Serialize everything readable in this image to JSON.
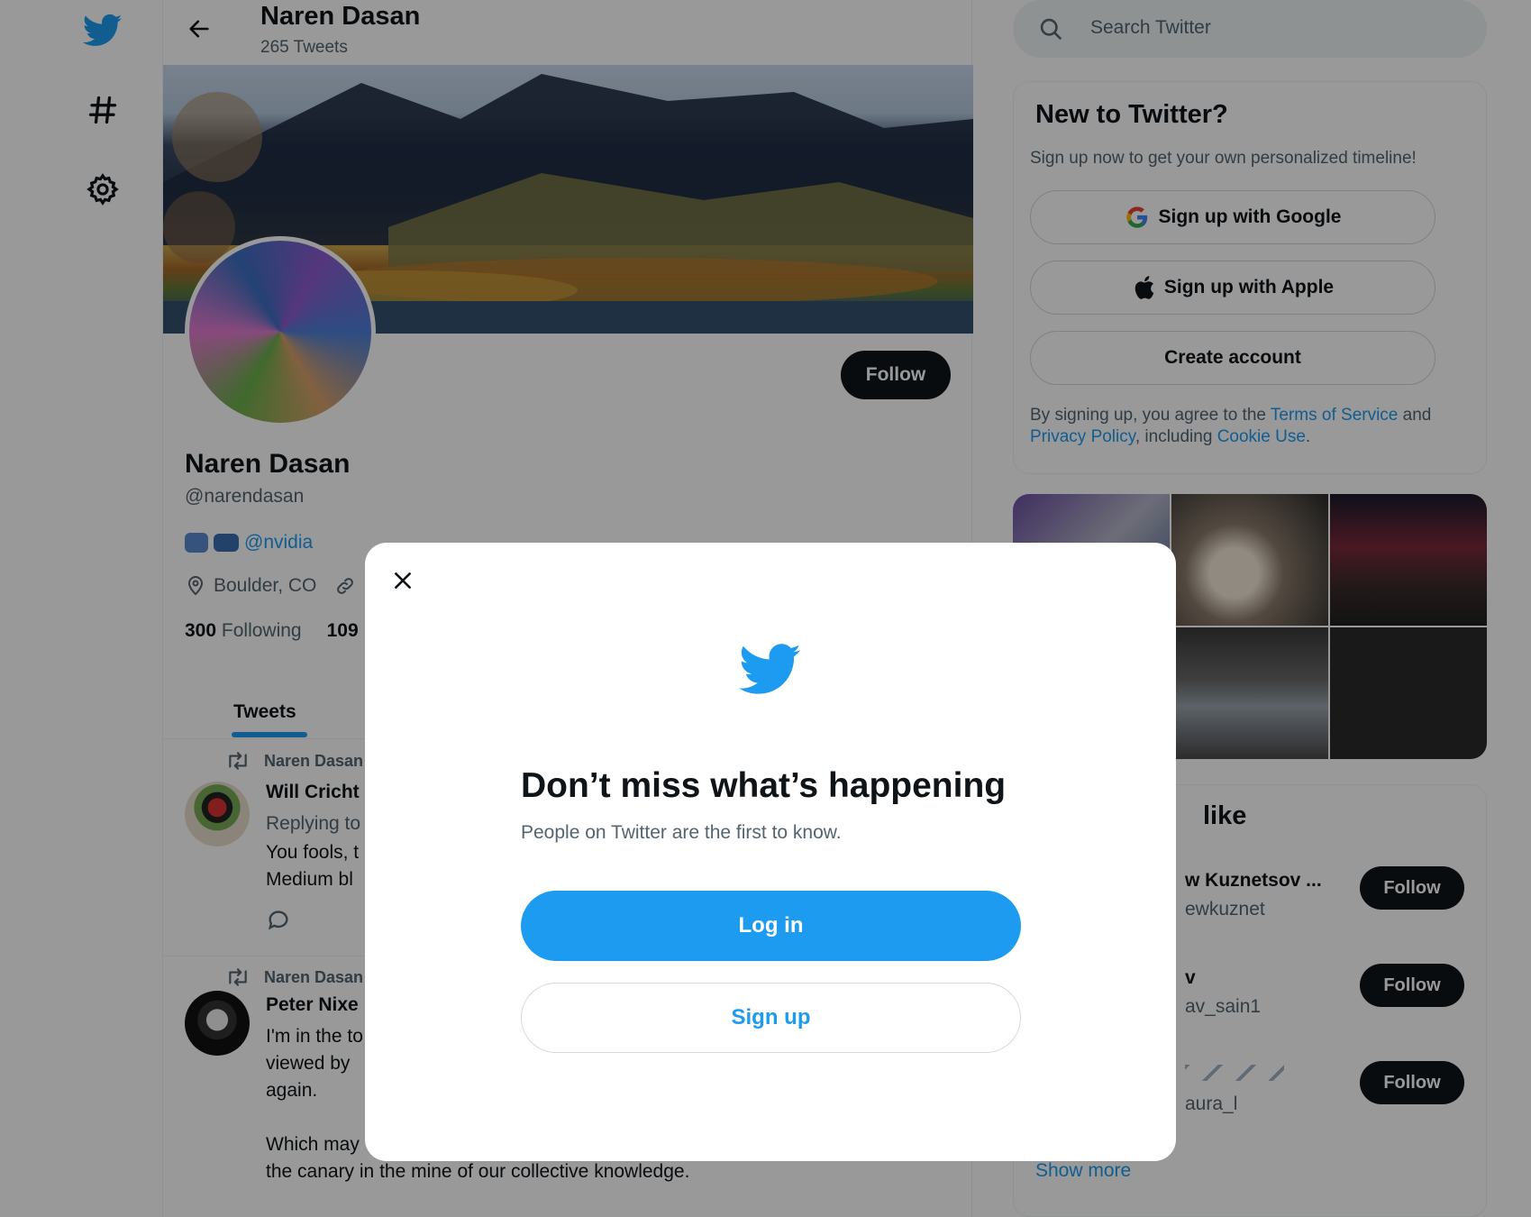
{
  "profile": {
    "name": "Naren Dasan",
    "tweet_count": "265 Tweets",
    "handle": "@narendasan",
    "bio_link": "@nvidia",
    "location": "Boulder, CO",
    "following_count": "300",
    "following_label": "Following",
    "followers_count": "109",
    "follow_label": "Follow"
  },
  "tabs": {
    "tweets_label": "Tweets"
  },
  "tweets": [
    {
      "retweeted_by": "Naren Dasan",
      "author": "Will Cricht",
      "reply_line": "Replying to",
      "text_1": "You fools, t",
      "text_2": "Medium bl"
    },
    {
      "retweeted_by": "Naren Dasan",
      "author": "Peter Nixe",
      "text_1": "I'm in the to",
      "text_2": "viewed by",
      "text_3": "again.",
      "text_4": "Which may",
      "text_5": "the canary in the mine of our collective knowledge."
    }
  ],
  "search": {
    "placeholder": "Search Twitter"
  },
  "new_to_twitter": {
    "title": "New to Twitter?",
    "subtitle": "Sign up now to get your own personalized timeline!",
    "google_label": "Sign up with Google",
    "apple_label": "Sign up with Apple",
    "create_label": "Create account",
    "terms_prefix": "By signing up, you agree to the ",
    "terms_link": "Terms of Service",
    "terms_and": " and",
    "privacy_link": "Privacy Policy",
    "terms_including": ", including ",
    "cookie_link": "Cookie Use",
    "terms_end": "."
  },
  "who_to_follow": {
    "title": "like",
    "rows": [
      {
        "name": "w Kuznetsov ...",
        "handle": "ewkuznet",
        "follow": "Follow"
      },
      {
        "name": "v",
        "handle": "av_sain1",
        "follow": "Follow"
      },
      {
        "name": "",
        "handle": "aura_l",
        "follow": "Follow"
      }
    ],
    "show_more": "Show more"
  },
  "modal": {
    "title": "Don’t miss what’s happening",
    "subtitle": "People on Twitter are the first to know.",
    "login_label": "Log in",
    "signup_label": "Sign up"
  },
  "colors": {
    "brand": "#1d9bf0",
    "text": "#0f1419",
    "muted": "#536471",
    "border": "#eff3f4"
  }
}
